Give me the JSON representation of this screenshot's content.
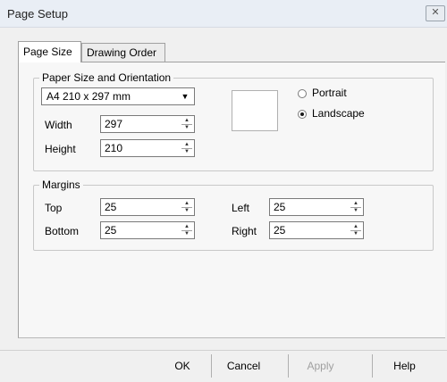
{
  "window": {
    "title": "Page Setup",
    "close_glyph": "✕"
  },
  "tabs": [
    {
      "label": "Page Size",
      "active": true
    },
    {
      "label": "Drawing Order",
      "active": false
    }
  ],
  "paper": {
    "group_label": "Paper Size and Orientation",
    "size_value": "A4 210 x 297 mm",
    "width_label": "Width",
    "width_value": "297",
    "height_label": "Height",
    "height_value": "210",
    "orientation": {
      "portrait_label": "Portrait",
      "landscape_label": "Landscape",
      "selected": "Landscape"
    }
  },
  "margins": {
    "group_label": "Margins",
    "top_label": "Top",
    "top_value": "25",
    "bottom_label": "Bottom",
    "bottom_value": "25",
    "left_label": "Left",
    "left_value": "25",
    "right_label": "Right",
    "right_value": "25"
  },
  "buttons": {
    "ok": "OK",
    "cancel": "Cancel",
    "apply": "Apply",
    "help": "Help"
  },
  "icons": {
    "combo_arrow": "chevron-down-icon",
    "spin_up": "spin-up-icon",
    "spin_down": "spin-down-icon"
  }
}
